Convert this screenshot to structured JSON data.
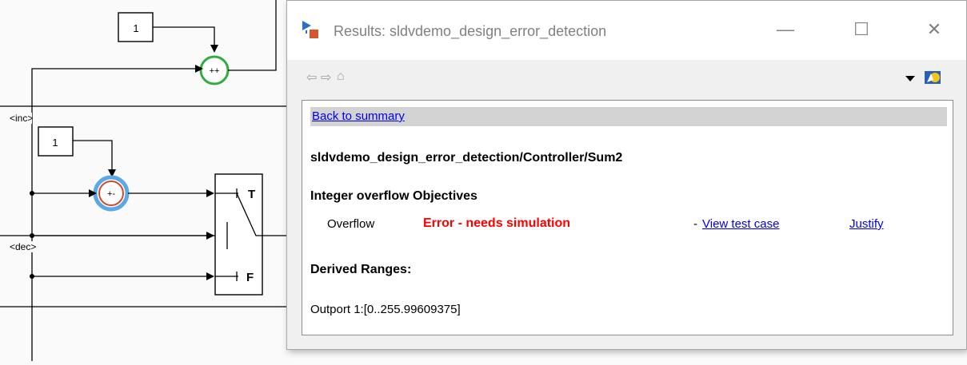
{
  "canvas": {
    "constant_top": "1",
    "constant_mid": "1",
    "sum_top_signs": "++",
    "sum_mid_signs": "+-",
    "port_inc": "<inc>",
    "port_dec": "<dec>",
    "switch_true": "T",
    "switch_false": "F"
  },
  "window": {
    "title": "Results: sldvdemo_design_error_detection",
    "minimize": "—",
    "maximize": "☐",
    "close": "✕"
  },
  "toolbar": {
    "back": "⇦",
    "forward": "⇨",
    "home": "⌂"
  },
  "content": {
    "back_link": "Back to summary",
    "block_path": "sldvdemo_design_error_detection/Controller/Sum2",
    "objectives_heading": "Integer overflow Objectives",
    "objective": {
      "name": "Overflow",
      "status": "Error - needs simulation",
      "dash": "-",
      "view_link": "View test case",
      "justify_link": "Justify"
    },
    "ranges_heading": "Derived Ranges:",
    "range_value": "Outport 1:[0..255.99609375]"
  },
  "colors": {
    "error": "#ff0000",
    "link": "#0000ee",
    "sum_top_ring": "#2eae3c",
    "sum_mid_ring": "#5aa9e6",
    "sum_mid_inner": "#d04a2a"
  }
}
